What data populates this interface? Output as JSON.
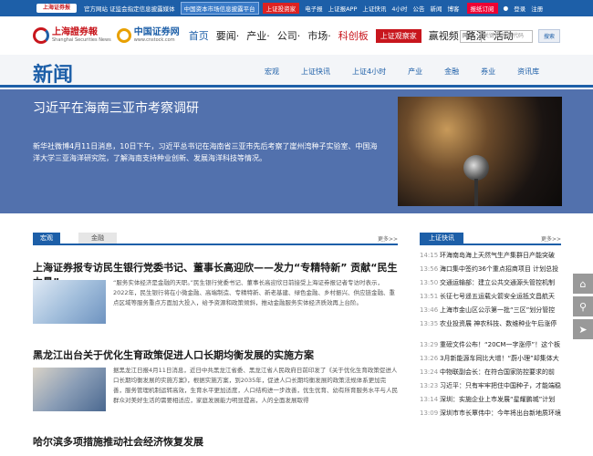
{
  "topbar": {
    "logo": "上海证券报",
    "items": [
      "官方网站 证监会指定信息披露媒体"
    ],
    "disclosure": "中国资本市场信息披露平台",
    "investor": "上证投资家",
    "links": [
      "电子报",
      "上证报APP",
      "上证快讯",
      "4小时",
      "公告",
      "新闻",
      "博客"
    ],
    "subscribe": "报纸订阅",
    "login": "登录",
    "register": "注册"
  },
  "header": {
    "logo1_title": "上海證券報",
    "logo1_sub": "Shanghai Securities News",
    "logo2_title": "中国证券网",
    "logo2_sub": "www.cnstock.com",
    "nav": [
      {
        "label": "首页",
        "style": "blue"
      },
      {
        "label": "要闻·",
        "style": ""
      },
      {
        "label": "产业·",
        "style": ""
      },
      {
        "label": "公司·",
        "style": ""
      },
      {
        "label": "市场·",
        "style": ""
      },
      {
        "label": "科创板",
        "style": "red"
      },
      {
        "label": "上证观察家",
        "style": "sec"
      },
      {
        "label": "赢视频",
        "style": ""
      },
      {
        "label": "路演",
        "style": ""
      },
      {
        "label": "活动",
        "style": ""
      }
    ],
    "search": {
      "select": "网页",
      "placeholder": "关键字/股票代码",
      "button": "搜索"
    }
  },
  "banner": {
    "title": "新闻",
    "subnav": [
      "宏观",
      "上证快讯",
      "上证4小时",
      "产业",
      "金融",
      "券业",
      "资讯库"
    ]
  },
  "hero": {
    "title": "习近平在海南三亚市考察调研",
    "desc": "新华社微博4月11日消息，10日下午，习近平总书记在海南省三亚市先后考察了崖州湾种子实验室、中国海洋大学三亚海洋研究院，了解海南支持种业创新、发展海洋科技等情况。"
  },
  "left": {
    "tabs": [
      "宏观",
      "金融"
    ],
    "more": "更多>>",
    "articles": [
      {
        "title": "上海证券报专访民生银行党委书记、董事长高迎欣——发力“专精特新” 贡献“民生力量”",
        "text": "“服务实体经济是金融的天职。”民生银行党委书记、董事长高迎欣日前接受上海证券报记者专访时表示，2022年，民生银行将在小微金融、高端制造、专精特新、新老基建、绿色金融、乡村振兴、供应链金融、重点区域等服务重点方面加大投入，给予资源和政策倾斜，推动金融服务实体经济质效再上台阶。"
      },
      {
        "title": "黑龙江出台关于优化生育政策促进人口长期均衡发展的实施方案",
        "text": "据黑龙江日报4月11日消息，近日中共黑龙江省委、黑龙江省人民政府日前印发了《关于优化生育政策促进人口长期均衡发展的实施方案》，根据实施方案，到2035年，促进人口长期均衡发展的政策法规体系更加完善，服务管理机制运转高效，生育水平更加适度，人口结构进一步改善，优生优育、幼有所育服务水平与人民群众对美好生活的需要相适应，家庭发展能力明显提高，人的全面发展取得"
      },
      {
        "title": "哈尔滨多项措施推动社会经济恢复发展",
        "text": ""
      }
    ]
  },
  "right": {
    "tab": "上证快讯",
    "more": "更多>>",
    "news": [
      {
        "time": "14:15",
        "text": "环海南岛海上天然气生产集群日产能突破"
      },
      {
        "time": "13:56",
        "text": "海口集中签约36个重点招商项目 计划总投"
      },
      {
        "time": "13:50",
        "text": "交通运输部：建立公共交通源头管控机制"
      },
      {
        "time": "13:51",
        "text": "长征七号遥五运载火箭安全运抵文昌航天"
      },
      {
        "time": "13:46",
        "text": "上海市金山区公示第一批“三区”划分管控"
      },
      {
        "time": "13:35",
        "text": "农业投资展 神农科技、数维种业午后涨停"
      },
      {
        "time": "13:29",
        "text": "重磅文件公布！“20CM一字涨停”！这个板"
      },
      {
        "time": "13:26",
        "text": "3月新能源车同比大增！“蔚小理”却集体大"
      },
      {
        "time": "13:24",
        "text": "中物联副会长：在符合国家防控要求的前"
      },
      {
        "time": "13:23",
        "text": "习近平：只有牢牢把住中国种子，才能端稳中"
      },
      {
        "time": "13:14",
        "text": "深圳：实施企业上市发展“星耀鹏城”计划"
      },
      {
        "time": "13:09",
        "text": "深圳市市长覃伟中：今年将出台新地质环境"
      }
    ]
  }
}
